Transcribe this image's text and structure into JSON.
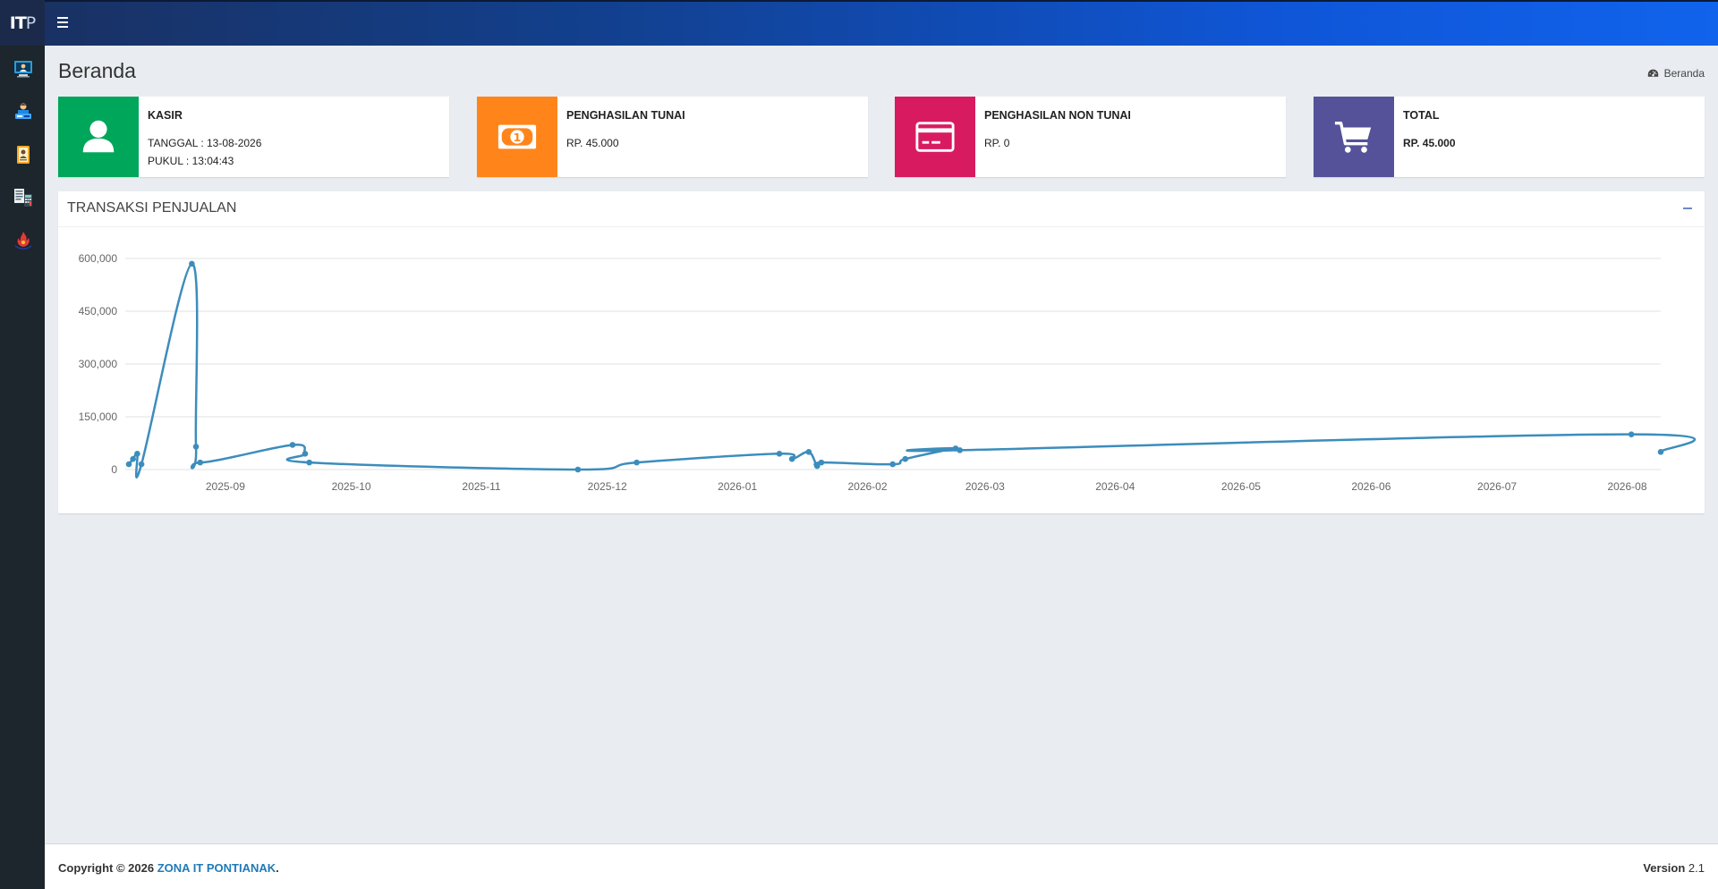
{
  "app": {
    "logo_strong": "IT",
    "logo_light": "P"
  },
  "header": {
    "menu_icon": "hamburger-icon"
  },
  "sidebar": {
    "items": [
      {
        "icon": "monitor-dashboard-icon"
      },
      {
        "icon": "cashier-user-icon"
      },
      {
        "icon": "product-id-card-icon"
      },
      {
        "icon": "report-calculator-icon"
      },
      {
        "icon": "fire-logo-icon"
      }
    ]
  },
  "page": {
    "title": "Beranda",
    "breadcrumb": "Beranda"
  },
  "info_boxes": [
    {
      "label": "KASIR",
      "line1": "TANGGAL : 13-08-2026",
      "line2": "PUKUL : 13:04:43",
      "color": "#00a65a",
      "icon": "user-icon"
    },
    {
      "label": "PENGHASILAN TUNAI",
      "line1": "RP. 45.000",
      "color": "#ff851b",
      "icon": "money-icon"
    },
    {
      "label": "PENGHASILAN NON TUNAI",
      "line1": "RP. 0",
      "color": "#d81b60",
      "icon": "credit-card-icon"
    },
    {
      "label": "TOTAL",
      "line1": "RP. 45.000",
      "color": "#555299",
      "icon": "cart-icon"
    }
  ],
  "chart_panel": {
    "title": "TRANSAKSI PENJUALAN"
  },
  "chart_data": {
    "type": "line",
    "title": "",
    "xlabel": "",
    "ylabel": "",
    "ylim": [
      0,
      600000
    ],
    "y_ticks": [
      "0",
      "150,000",
      "300,000",
      "450,000",
      "600,000"
    ],
    "x_ticks": [
      "2025-09",
      "2025-10",
      "2025-11",
      "2025-12",
      "2026-01",
      "2026-02",
      "2026-03",
      "2026-04",
      "2026-05",
      "2026-06",
      "2026-07",
      "2026-08"
    ],
    "grid": true,
    "color": "#3c8dbc",
    "series": [
      {
        "x": [
          "2025-08-09",
          "2025-08-10",
          "2025-08-11",
          "2025-08-12",
          "2025-08-24",
          "2025-08-25",
          "2025-08-26",
          "2025-09-17",
          "2025-09-20",
          "2025-09-21",
          "2025-11-24",
          "2025-12-08",
          "2026-01-11",
          "2026-01-14",
          "2026-01-18",
          "2026-01-20",
          "2026-01-21",
          "2026-02-07",
          "2026-02-10",
          "2026-02-22",
          "2026-02-23",
          "2026-08-02",
          "2026-08-09"
        ],
        "y": [
          15000,
          30000,
          45000,
          15000,
          585000,
          65000,
          20000,
          70000,
          45000,
          20000,
          0,
          20000,
          45000,
          30000,
          50000,
          10000,
          20000,
          15000,
          30000,
          60000,
          55000,
          100000,
          50000
        ]
      }
    ]
  },
  "footer": {
    "copyright": "Copyright © 2026",
    "company": "ZONA IT PONTIANAK",
    "version_label": "Version",
    "version": "2.1"
  }
}
